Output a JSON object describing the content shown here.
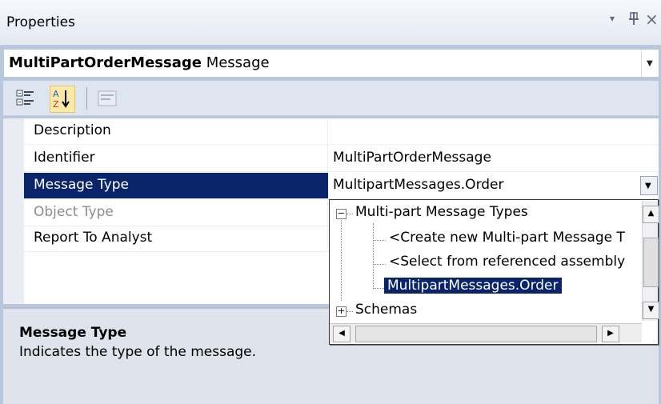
{
  "window": {
    "title": "Properties",
    "controls": {
      "dropdown": "▾",
      "pin": "ф",
      "close": "×"
    }
  },
  "object_selector": {
    "name": "MultiPartOrderMessage",
    "type": "Message"
  },
  "toolbar": {
    "buttons": [
      {
        "name": "categorized",
        "icon": "categorized-icon"
      },
      {
        "name": "alphabetical",
        "icon": "alphabetical-sort-icon",
        "active": true
      },
      {
        "name": "property-pages",
        "icon": "property-pages-icon",
        "enabled": false
      }
    ]
  },
  "grid": {
    "rows": [
      {
        "name": "Description",
        "value": ""
      },
      {
        "name": "Identifier",
        "value": "MultiPartOrderMessage"
      },
      {
        "name": "Message Type",
        "value": "MultipartMessages.Order",
        "selected": true
      },
      {
        "name": "Object Type",
        "value": "",
        "disabled": true
      },
      {
        "name": "Report To Analyst",
        "value": ""
      }
    ]
  },
  "dropdown_tree": {
    "root": "Multi-part Message Types",
    "children": [
      "<Create new Multi-part Message T",
      "<Select from referenced assembly",
      "MultipartMessages.Order"
    ],
    "selected": "MultipartMessages.Order",
    "second_root": "Schemas"
  },
  "description": {
    "title": "Message Type",
    "text": "Indicates the type of the message."
  },
  "colors": {
    "selection": "#0a246a",
    "panel_bg": "#dfe4ec",
    "window_bg": "#b9c7dd"
  }
}
